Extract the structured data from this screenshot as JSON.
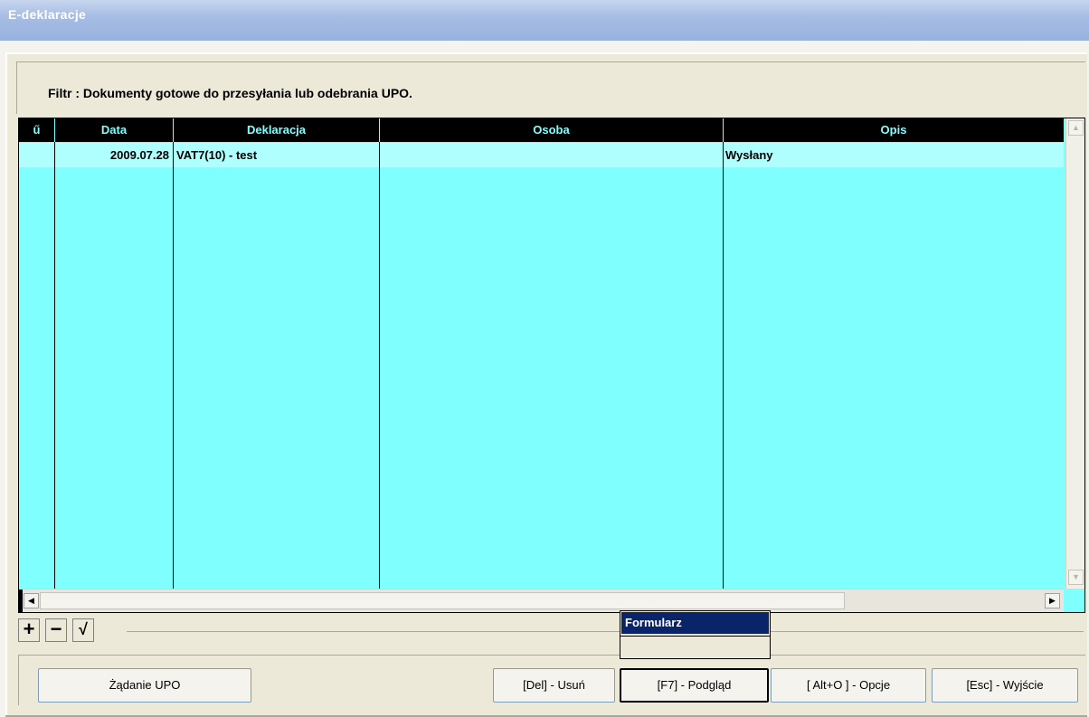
{
  "window": {
    "title": "E-deklaracje"
  },
  "filter": {
    "text": "Filtr : Dokumenty gotowe do przesyłania lub odebrania UPO."
  },
  "grid": {
    "columns": [
      "ű",
      "Data",
      "Deklaracja",
      "Osoba",
      "Opis"
    ],
    "rows": [
      {
        "mark": "",
        "data": "2009.07.28",
        "deklaracja": "VAT7(10) - test",
        "osoba": "",
        "opis": "Wysłany"
      }
    ]
  },
  "navigator": {
    "add": "+",
    "remove": "−",
    "post": "√"
  },
  "popup": {
    "items": [
      "Formularz"
    ]
  },
  "buttons": {
    "upo": "Żądanie UPO",
    "delete": "[Del] - Usuń",
    "preview": "[F7] - Podgląd",
    "options": "[ Alt+O ] - Opcje",
    "exit": "[Esc] - Wyjście"
  },
  "colors": {
    "grid_background": "#80ffff",
    "row_selected": "#b0ffff",
    "header_background": "#000000",
    "header_text": "#80ffff",
    "menu_highlight": "#0a246a"
  }
}
